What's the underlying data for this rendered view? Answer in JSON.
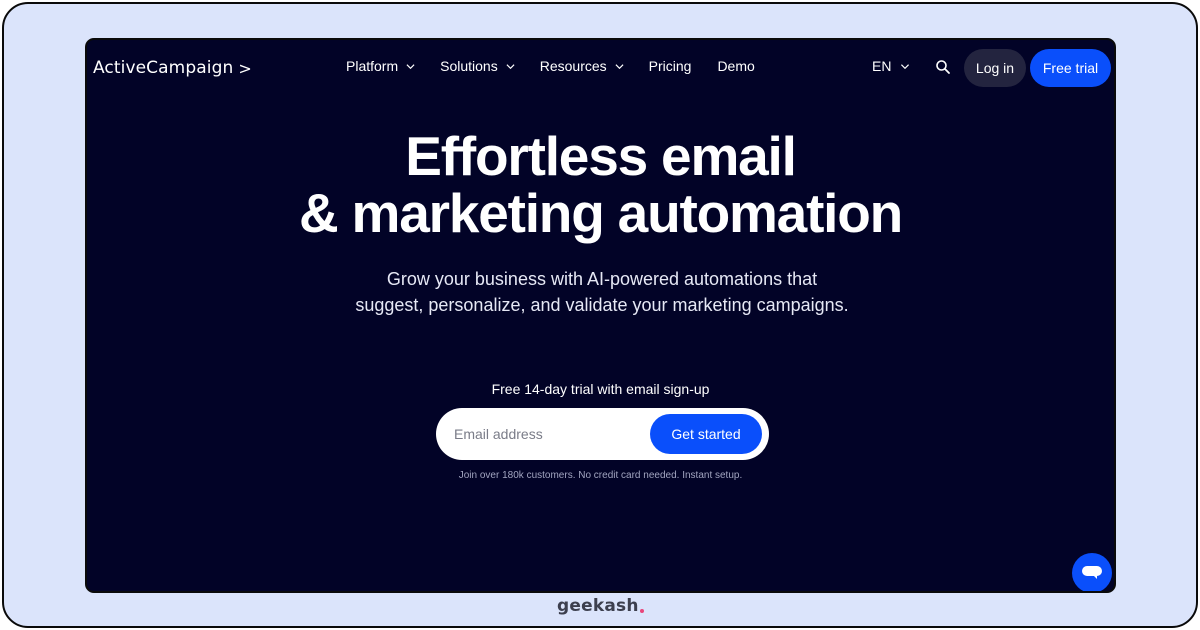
{
  "nav": {
    "logo": "ActiveCampaign",
    "logo_chevron": ">",
    "links": [
      {
        "label": "Platform",
        "dropdown": true
      },
      {
        "label": "Solutions",
        "dropdown": true
      },
      {
        "label": "Resources",
        "dropdown": true
      },
      {
        "label": "Pricing",
        "dropdown": false
      },
      {
        "label": "Demo",
        "dropdown": false
      }
    ],
    "language": "EN",
    "search_icon": "search-icon",
    "login_label": "Log in",
    "free_trial_label": "Free trial"
  },
  "hero": {
    "headline_line1": "Effortless email",
    "headline_line2": "& marketing automation",
    "subheading": "Grow your business with AI-powered automations that suggest, personalize, and validate your marketing campaigns.",
    "trial_note": "Free 14-day trial with email sign-up",
    "email_placeholder": "Email address",
    "email_value": "",
    "cta_label": "Get started",
    "disclaimer": "Join over 180k customers. No credit card needed. Instant setup."
  },
  "chat": {
    "icon": "chat-bubble-icon"
  },
  "watermark": {
    "text": "geekash"
  },
  "colors": {
    "background": "#020327",
    "accent": "#0a4ffb",
    "login_bg": "#23243f",
    "frame": "#dbe4fb"
  }
}
